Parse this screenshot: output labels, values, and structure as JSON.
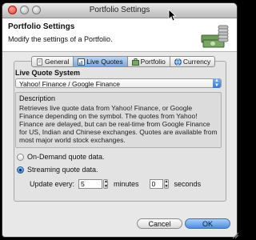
{
  "window": {
    "title": "Portfolio Settings"
  },
  "header": {
    "title": "Portfolio Settings",
    "subtitle": "Modify the settings of a Portfolio.",
    "icon": "money-stack-icon"
  },
  "tabs": [
    {
      "label": "General",
      "icon": "document-icon",
      "active": false
    },
    {
      "label": "Live Quotes",
      "icon": "quotes-icon",
      "active": true
    },
    {
      "label": "Portfolio",
      "icon": "portfolio-icon",
      "active": false
    },
    {
      "label": "Currency",
      "icon": "currency-icon",
      "active": false
    }
  ],
  "live_quotes": {
    "group_label": "Live Quote System",
    "selected_system": "Yahoo! Finance / Google Finance",
    "description_label": "Description",
    "description_text": "Retrieves live quote data from Yahoo! Finance, or Google Finance depending on the symbol. The quotes from Yahoo! Finance are delayed, but can be real-time from Google Finance for US, Indian and Chinese exchanges. Quotes are available from most major world stock exchanges.",
    "option_on_demand": "On-Demand quote data.",
    "option_streaming": "Streaming quote data.",
    "selected_option": "streaming",
    "update_every_label": "Update every:",
    "minutes_value": "5",
    "minutes_label": "minutes",
    "seconds_value": "0",
    "seconds_label": "seconds"
  },
  "buttons": {
    "cancel": "Cancel",
    "ok": "OK"
  },
  "colors": {
    "accent": "#4f8edd",
    "close": "#d6392a"
  }
}
